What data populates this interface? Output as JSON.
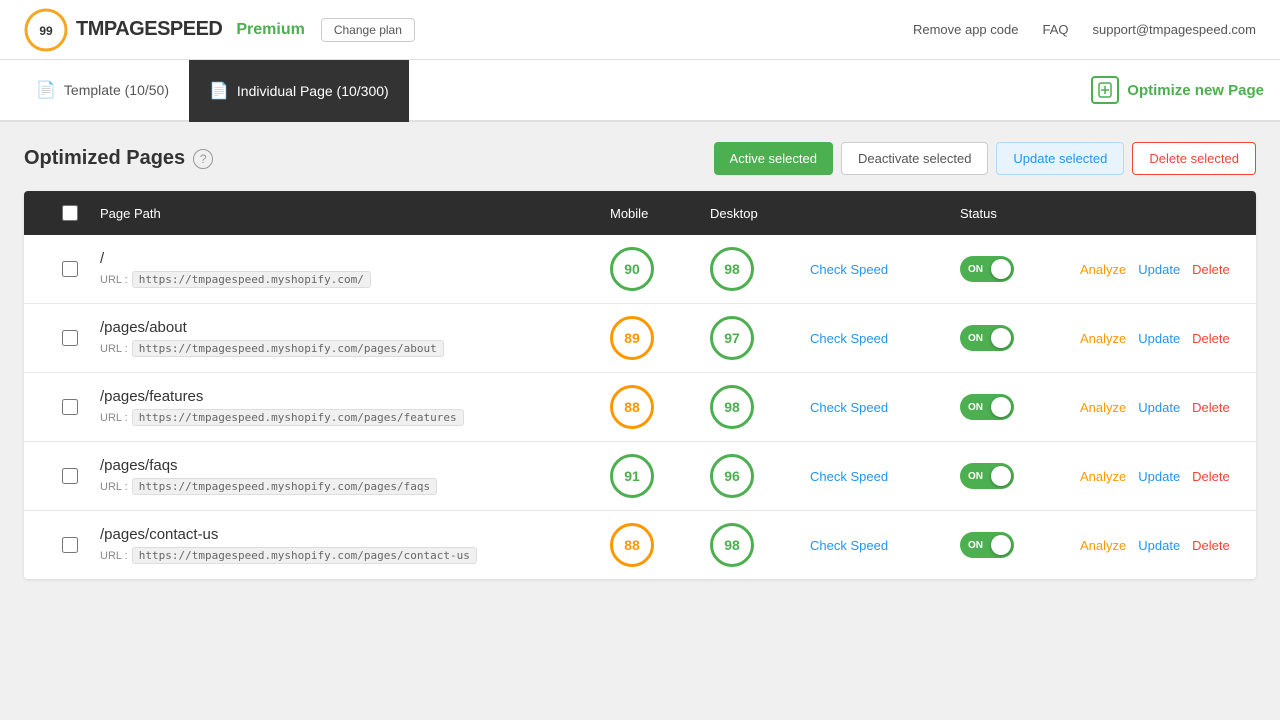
{
  "header": {
    "logo_number": "99",
    "logo_text": "TMPAGESPEED",
    "premium_label": "Premium",
    "change_plan_label": "Change plan",
    "nav_items": [
      {
        "id": "remove-app-code",
        "label": "Remove app code"
      },
      {
        "id": "faq",
        "label": "FAQ"
      },
      {
        "id": "support",
        "label": "support@tmpagespeed.com"
      }
    ]
  },
  "tabs": {
    "items": [
      {
        "id": "template",
        "label": "Template (10/50)",
        "active": false
      },
      {
        "id": "individual-page",
        "label": "Individual Page (10/300)",
        "active": true
      }
    ],
    "optimize_new_label": "Optimize new Page"
  },
  "section": {
    "title": "Optimized Pages",
    "help_icon": "?",
    "buttons": {
      "active_selected": "Active selected",
      "deactivate_selected": "Deactivate selected",
      "update_selected": "Update selected",
      "delete_selected": "Delete selected"
    }
  },
  "table": {
    "headers": [
      {
        "id": "checkbox",
        "label": ""
      },
      {
        "id": "page-path",
        "label": "Page Path"
      },
      {
        "id": "mobile",
        "label": "Mobile"
      },
      {
        "id": "desktop",
        "label": "Desktop"
      },
      {
        "id": "speed",
        "label": ""
      },
      {
        "id": "status",
        "label": "Status"
      },
      {
        "id": "actions",
        "label": ""
      }
    ],
    "rows": [
      {
        "id": "row-1",
        "path": "/",
        "url": "https://tmpagespeed.myshopify.com/",
        "mobile_score": 90,
        "mobile_color": "green",
        "desktop_score": 98,
        "desktop_color": "green",
        "check_speed": "Check Speed",
        "status": "ON",
        "actions": {
          "analyze": "Analyze",
          "update": "Update",
          "delete": "Delete"
        }
      },
      {
        "id": "row-2",
        "path": "/pages/about",
        "url": "https://tmpagespeed.myshopify.com/pages/about",
        "mobile_score": 89,
        "mobile_color": "orange",
        "desktop_score": 97,
        "desktop_color": "green",
        "check_speed": "Check Speed",
        "status": "ON",
        "actions": {
          "analyze": "Analyze",
          "update": "Update",
          "delete": "Delete"
        }
      },
      {
        "id": "row-3",
        "path": "/pages/features",
        "url": "https://tmpagespeed.myshopify.com/pages/features",
        "mobile_score": 88,
        "mobile_color": "orange",
        "desktop_score": 98,
        "desktop_color": "green",
        "check_speed": "Check Speed",
        "status": "ON",
        "actions": {
          "analyze": "Analyze",
          "update": "Update",
          "delete": "Delete"
        }
      },
      {
        "id": "row-4",
        "path": "/pages/faqs",
        "url": "https://tmpagespeed.myshopify.com/pages/faqs",
        "mobile_score": 91,
        "mobile_color": "green",
        "desktop_score": 96,
        "desktop_color": "green",
        "check_speed": "Check Speed",
        "status": "ON",
        "actions": {
          "analyze": "Analyze",
          "update": "Update",
          "delete": "Delete"
        }
      },
      {
        "id": "row-5",
        "path": "/pages/contact-us",
        "url": "https://tmpagespeed.myshopify.com/pages/contact-us",
        "mobile_score": 88,
        "mobile_color": "orange",
        "desktop_score": 98,
        "desktop_color": "green",
        "check_speed": "Check Speed",
        "status": "ON",
        "actions": {
          "analyze": "Analyze",
          "update": "Update",
          "delete": "Delete"
        }
      }
    ]
  }
}
